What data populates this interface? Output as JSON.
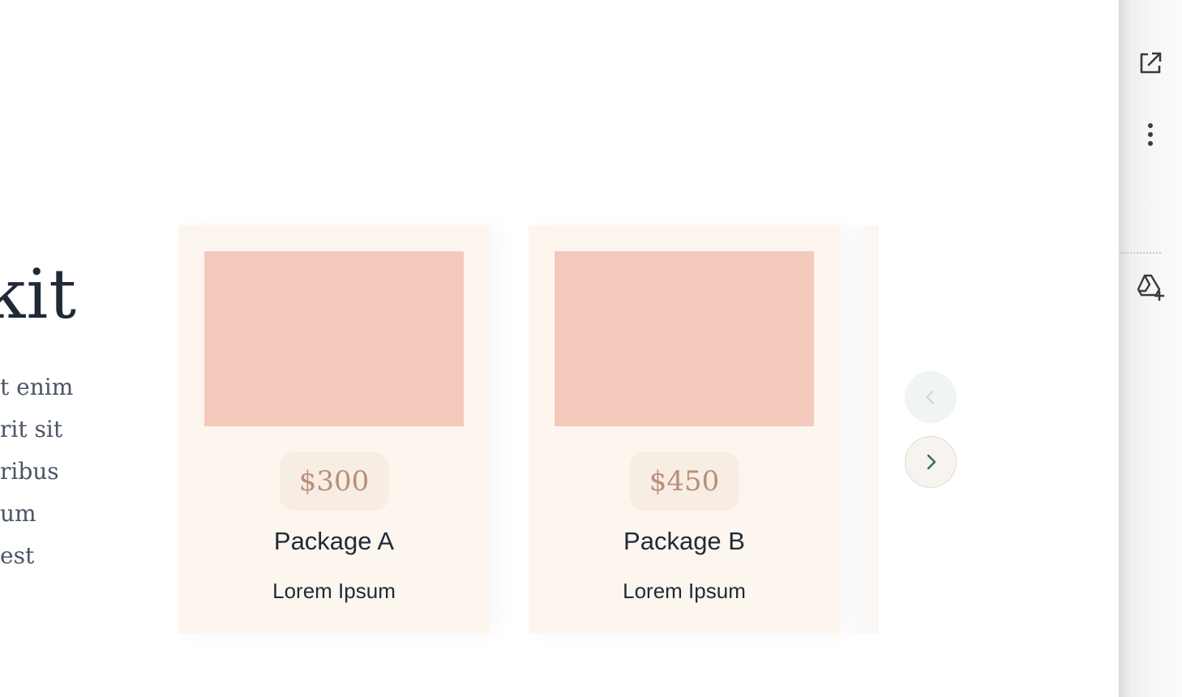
{
  "hero": {
    "title_fragment": "kit",
    "body_fragments": [
      "t enim",
      "rit sit",
      "ribus",
      "um",
      "est"
    ]
  },
  "packages": [
    {
      "price": "$300",
      "name": "Package A",
      "description": "Lorem Ipsum"
    },
    {
      "price": "$450",
      "name": "Package B",
      "description": "Lorem Ipsum"
    }
  ],
  "carousel": {
    "prev_icon": "chevron-left-icon",
    "next_icon": "chevron-right-icon"
  },
  "side_panel": {
    "icons": [
      "open-external-icon",
      "more-vertical-icon",
      "add-to-drive-icon"
    ]
  },
  "colors": {
    "card_background": "#fdf6ee",
    "image_placeholder": "#f4c9bc",
    "price_pill": "#f7ede2",
    "price_text": "#b98e7a",
    "heading_text": "#1f2a37",
    "accent_teal": "#2f6b5e"
  }
}
